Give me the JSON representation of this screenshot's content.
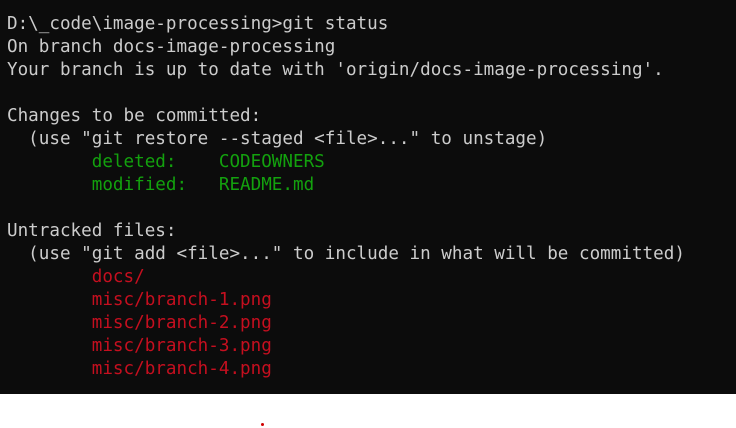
{
  "terminal": {
    "lines": [
      {
        "text": "D:\\_code\\image-processing>git status",
        "kind": "prompt"
      },
      {
        "text": "On branch docs-image-processing",
        "kind": "normal"
      },
      {
        "text": "Your branch is up to date with 'origin/docs-image-processing'.",
        "kind": "normal"
      },
      {
        "text": "",
        "kind": "blank"
      },
      {
        "text": "Changes to be committed:",
        "kind": "normal"
      },
      {
        "text": "  (use \"git restore --staged <file>...\" to unstage)",
        "kind": "normal"
      },
      {
        "text": "        deleted:    CODEOWNERS",
        "kind": "staged"
      },
      {
        "text": "        modified:   README.md",
        "kind": "staged"
      },
      {
        "text": "",
        "kind": "blank"
      },
      {
        "text": "Untracked files:",
        "kind": "normal"
      },
      {
        "text": "  (use \"git add <file>...\" to include in what will be committed)",
        "kind": "normal"
      },
      {
        "text": "        docs/",
        "kind": "untracked"
      },
      {
        "text": "        misc/branch-1.png",
        "kind": "untracked"
      },
      {
        "text": "        misc/branch-2.png",
        "kind": "untracked"
      },
      {
        "text": "        misc/branch-3.png",
        "kind": "untracked"
      },
      {
        "text": "        misc/branch-4.png",
        "kind": "untracked"
      }
    ]
  },
  "colors": {
    "background": "#0c0c0c",
    "default_text": "#cccccc",
    "staged": "#13a10e",
    "untracked": "#c50f1f"
  }
}
